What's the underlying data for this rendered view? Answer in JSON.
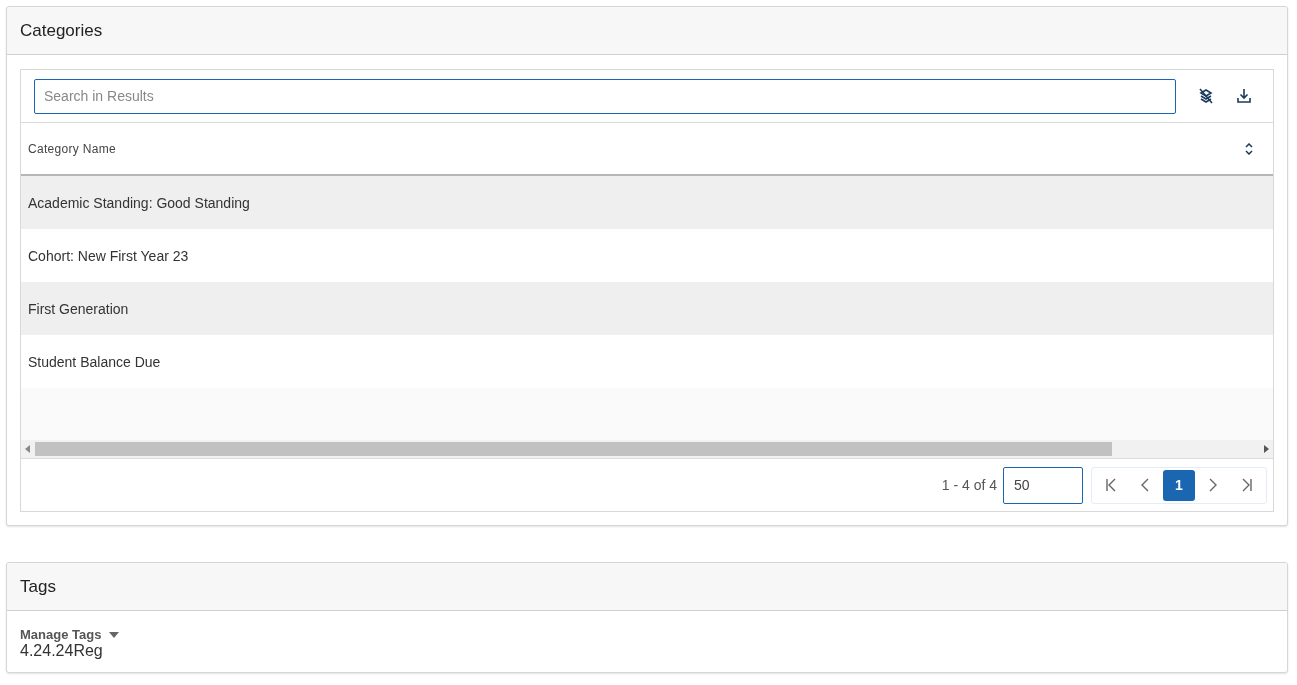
{
  "categories_panel": {
    "title": "Categories",
    "search": {
      "placeholder": "Search in Results"
    },
    "table": {
      "columns": [
        {
          "label": "Category Name"
        }
      ],
      "rows": [
        {
          "name": "Academic Standing: Good Standing"
        },
        {
          "name": "Cohort: New First Year 23"
        },
        {
          "name": "First Generation"
        },
        {
          "name": "Student Balance Due"
        }
      ]
    },
    "pager": {
      "range": "1 - 4 of 4",
      "page_size": "50",
      "pages": [
        {
          "label": "1",
          "selected": true
        }
      ]
    }
  },
  "tags_panel": {
    "title": "Tags",
    "label": "Manage Tags",
    "value": "4.24.24Reg"
  }
}
